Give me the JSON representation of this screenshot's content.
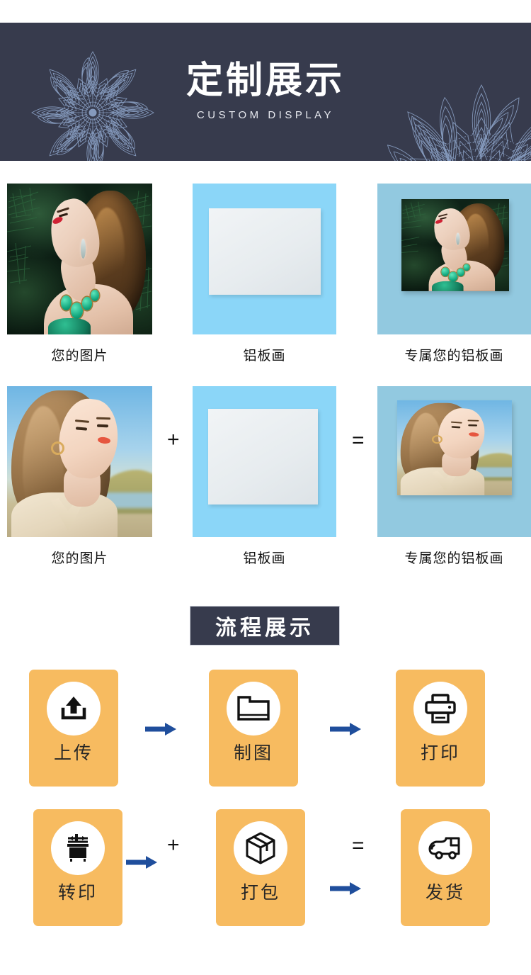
{
  "banner": {
    "title": "定制展示",
    "subtitle": "CUSTOM DISPLAY",
    "bg_color": "#373b4d",
    "ornament_color": "#8aa0c4",
    "left_ornament": "mandala-snowflake-ornament",
    "right_ornament": "mandala-corner-ornament"
  },
  "comparison": {
    "rows": [
      {
        "source": {
          "label": "您的图片",
          "image": "portrait-woman-green-forest-emerald-necklace"
        },
        "operator_plus": "+",
        "product": {
          "label": "铝板画",
          "image": "blank-aluminum-print-plate-blue-background",
          "bg_color": "#8bd6f8"
        },
        "operator_equals": "=",
        "result": {
          "label": "专属您的铝板画",
          "image": "aluminum-print-with-forest-portrait",
          "bg_color": "#92c9e0"
        }
      },
      {
        "source": {
          "label": "您的图片",
          "image": "portrait-woman-outdoor-sunny-beige-shirt"
        },
        "operator_plus": "+",
        "product": {
          "label": "铝板画",
          "image": "blank-aluminum-print-plate-blue-background",
          "bg_color": "#8bd6f8"
        },
        "operator_equals": "=",
        "result": {
          "label": "专属您的铝板画",
          "image": "aluminum-print-with-outdoor-portrait",
          "bg_color": "#92c9e0"
        }
      }
    ]
  },
  "process": {
    "title": "流程展示",
    "title_bg_color": "#373b4d",
    "card_color": "#f7bb60",
    "arrow_color": "#1f4e9c",
    "steps": [
      {
        "label": "上传",
        "icon": "upload-icon"
      },
      {
        "label": "制图",
        "icon": "folder-icon"
      },
      {
        "label": "打印",
        "icon": "printer-icon"
      },
      {
        "label": "转印",
        "icon": "heat-press-icon"
      },
      {
        "label": "打包",
        "icon": "box-icon"
      },
      {
        "label": "发货",
        "icon": "delivery-truck-icon"
      }
    ],
    "arrows": [
      "arrow-right-icon",
      "arrow-right-icon",
      "arrow-right-icon",
      "arrow-right-icon"
    ]
  }
}
